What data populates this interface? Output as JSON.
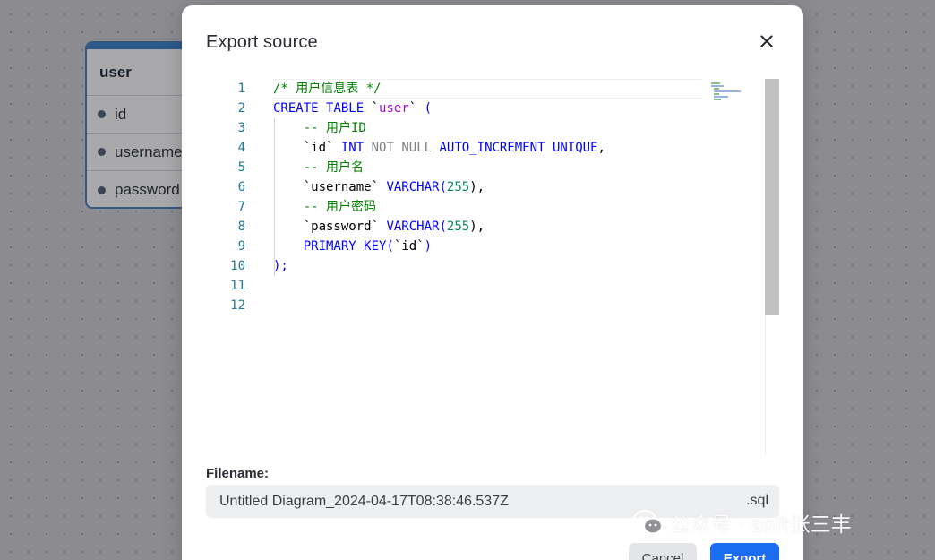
{
  "er_table": {
    "name": "user",
    "fields": [
      "id",
      "username",
      "password"
    ]
  },
  "modal": {
    "title": "Export source",
    "close_icon": "close-icon"
  },
  "editor": {
    "line_numbers": [
      "1",
      "2",
      "3",
      "4",
      "5",
      "6",
      "7",
      "8",
      "9",
      "10",
      "11",
      "12"
    ],
    "lines": [
      "/* 用户信息表 */",
      "CREATE TABLE `user` (",
      "    -- 用户ID",
      "    `id` INT NOT NULL AUTO_INCREMENT UNIQUE,",
      "    -- 用户名",
      "    `username` VARCHAR(255),",
      "    -- 用户密码",
      "    `password` VARCHAR(255),",
      "    PRIMARY KEY(`id`)",
      ");",
      "",
      ""
    ]
  },
  "filename": {
    "label": "Filename:",
    "value": "Untitled Diagram_2024-04-17T08:38:46.537Z",
    "extension": ".sql"
  },
  "buttons": {
    "cancel": "Cancel",
    "export": "Export"
  },
  "watermark": {
    "text": "公众号 · soft张三丰",
    "icon": "wechat-icon"
  },
  "colors": {
    "accent": "#1a6cf0",
    "line_number": "#237893",
    "comment": "#008000",
    "keyword": "#0000ff"
  }
}
